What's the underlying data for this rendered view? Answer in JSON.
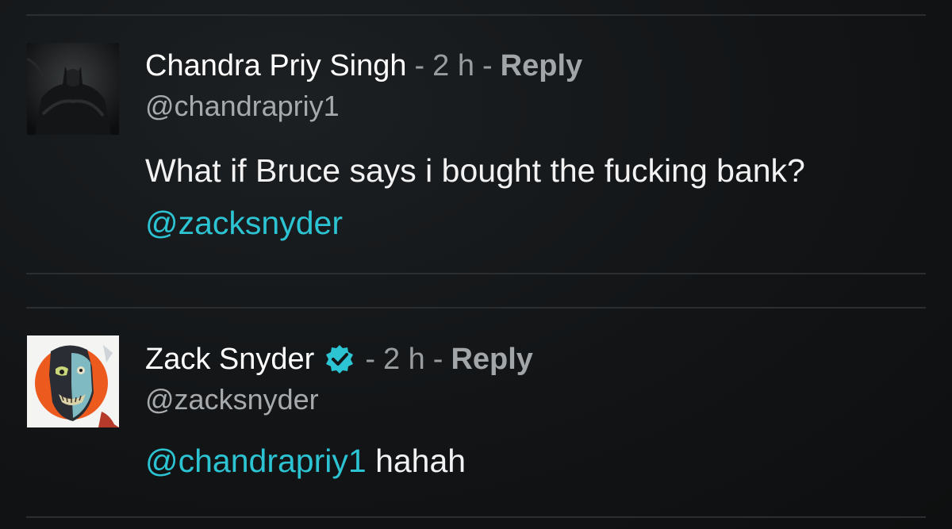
{
  "comments": [
    {
      "author_name": "Chandra Priy Singh",
      "time": "2 h",
      "reply_label": "Reply",
      "handle": "@chandrapriy1",
      "text_before": "What if Bruce says i bought the fucking bank?",
      "mention": "@zacksnyder",
      "text_after": "",
      "verified": false,
      "avatar_icon": "batman-avatar"
    },
    {
      "author_name": "Zack Snyder",
      "time": "2 h",
      "reply_label": "Reply",
      "handle": "@zacksnyder",
      "text_before": "",
      "mention": "@chandrapriy1",
      "text_after": "hahah",
      "verified": true,
      "avatar_icon": "zombie-avatar"
    }
  ],
  "separator": "-",
  "colors": {
    "mention": "#2cc3d2",
    "verified_badge": "#2cc3d2",
    "meta": "#9a9d9f",
    "background": "#121416"
  }
}
